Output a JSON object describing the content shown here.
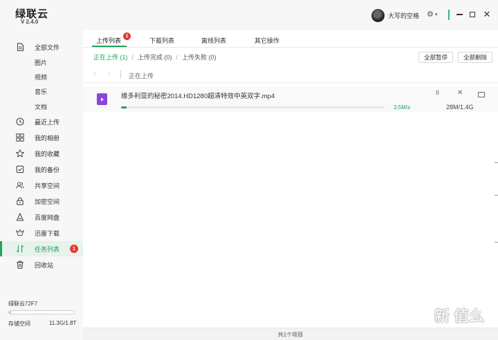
{
  "app": {
    "name": "绿联云",
    "version": "V 2.4.0",
    "user_name": "大写的空格"
  },
  "sidebar": {
    "items": [
      {
        "label": "全部文件",
        "icon": "document-icon"
      },
      {
        "label": "图片",
        "icon": ""
      },
      {
        "label": "视频",
        "icon": ""
      },
      {
        "label": "音乐",
        "icon": ""
      },
      {
        "label": "文档",
        "icon": ""
      },
      {
        "label": "最近上传",
        "icon": "clock-icon"
      },
      {
        "label": "我的相册",
        "icon": "grid-icon"
      },
      {
        "label": "我的收藏",
        "icon": "star-icon"
      },
      {
        "label": "我的备份",
        "icon": "backup-icon"
      },
      {
        "label": "共享空间",
        "icon": "users-icon"
      },
      {
        "label": "加密空间",
        "icon": "lock-icon"
      },
      {
        "label": "百度网盘",
        "icon": "cloud-drive-icon"
      },
      {
        "label": "迅雷下载",
        "icon": "bird-icon"
      },
      {
        "label": "任务列表",
        "icon": "sort-icon",
        "badge": "1",
        "active": true
      },
      {
        "label": "回收站",
        "icon": "trash-icon"
      }
    ],
    "device_name": "绿联云72F7",
    "storage_label": "存储空间",
    "storage_value": "11.3G/1.8T",
    "storage_fraction": 0.006
  },
  "tabs": [
    {
      "label": "上传列表",
      "badge": "1",
      "active": true
    },
    {
      "label": "下载列表"
    },
    {
      "label": "离线列表"
    },
    {
      "label": "其它操作"
    }
  ],
  "filters": {
    "uploading": "正在上传 (1)",
    "completed": "上传完成 (0)",
    "failed": "上传失败 (0)"
  },
  "actions": {
    "pause_all": "全部暂停",
    "delete_all": "全部删除"
  },
  "path": {
    "current": "正在上传"
  },
  "task": {
    "file_name": "维多利亚的秘密2014.HD1280超清特效中英双字.mp4",
    "speed": "3.5M/s",
    "size": "28M/1.4G",
    "progress_fraction": 0.02,
    "pause_glyph": "II",
    "cancel_glyph": "✕"
  },
  "footer": {
    "count_text": "共1个项目"
  },
  "watermark": "新 值么",
  "colors": {
    "accent": "#1fa35e",
    "badge": "#e53935",
    "file_icon": "#8a46d8"
  }
}
